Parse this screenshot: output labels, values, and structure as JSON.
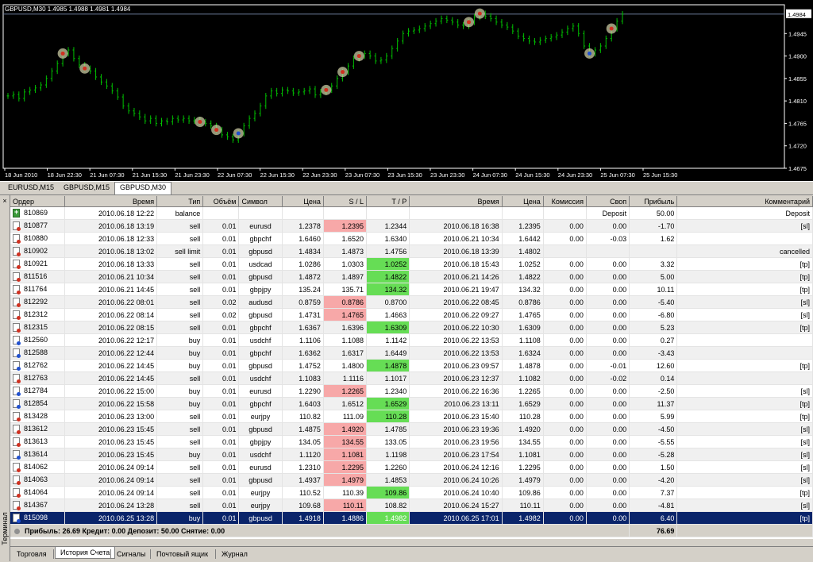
{
  "chart": {
    "title": "GBPUSD,M30  1.4985 1.4988 1.4981 1.4984",
    "current_price": "1.4984",
    "price_labels": [
      "1.4945",
      "1.4900",
      "1.4855",
      "1.4810",
      "1.4765",
      "1.4720",
      "1.4675"
    ],
    "time_labels": [
      "18 Jun 2010",
      "18 Jun 22:30",
      "21 Jun 07:30",
      "21 Jun 15:30",
      "21 Jun 23:30",
      "22 Jun 07:30",
      "22 Jun 15:30",
      "22 Jun 23:30",
      "23 Jun 07:30",
      "23 Jun 15:30",
      "23 Jun 23:30",
      "24 Jun 07:30",
      "24 Jun 15:30",
      "24 Jun 23:30",
      "25 Jun 07:30",
      "25 Jun 15:30"
    ],
    "colors": {
      "background": "#000000",
      "bars": "#00c000",
      "grid": "#ffffff",
      "sell_marker": "#d03020",
      "buy_marker": "#2050d0",
      "marker_ring": "#c8c8a0"
    },
    "series": [
      1.482,
      1.4823,
      1.4815,
      1.4828,
      1.4832,
      1.4836,
      1.4842,
      1.4855,
      1.487,
      1.4885,
      1.4905,
      1.4912,
      1.4895,
      1.4882,
      1.4875,
      1.487,
      1.4858,
      1.4848,
      1.484,
      1.483,
      1.4818,
      1.48,
      1.479,
      1.4785,
      1.4778,
      1.477,
      1.4775,
      1.4765,
      1.477,
      1.4768,
      1.4775,
      1.4772,
      1.4775,
      1.477,
      1.4772,
      1.4768,
      1.4765,
      1.476,
      1.4752,
      1.4742,
      1.4738,
      1.4732,
      1.4745,
      1.476,
      1.4775,
      1.4785,
      1.48,
      1.482,
      1.483,
      1.4825,
      1.4832,
      1.483,
      1.4826,
      1.4828,
      1.483,
      1.4834,
      1.4822,
      1.4828,
      1.4832,
      1.484,
      1.4855,
      1.4868,
      1.488,
      1.4895,
      1.49,
      1.4905,
      1.49,
      1.489,
      1.4892,
      1.49,
      1.4915,
      1.493,
      1.4945,
      1.495,
      1.4952,
      1.4955,
      1.496,
      1.4965,
      1.497,
      1.4975,
      1.4972,
      1.4968,
      1.4962,
      1.496,
      1.4968,
      1.4978,
      1.4985,
      1.498,
      1.4975,
      1.4968,
      1.4962,
      1.4958,
      1.495,
      1.494,
      1.4935,
      1.493,
      1.4928,
      1.4932,
      1.4935,
      1.4938,
      1.4942,
      1.4948,
      1.4955,
      1.496,
      1.4945,
      1.492,
      1.4905,
      1.4912,
      1.492,
      1.4935,
      1.4955,
      1.497,
      1.4984
    ],
    "trades": [
      {
        "side": "sell",
        "i": 10
      },
      {
        "side": "sell",
        "i": 14
      },
      {
        "side": "sell",
        "i": 35
      },
      {
        "side": "sell",
        "i": 38
      },
      {
        "side": "buy",
        "i": 42
      },
      {
        "side": "sell",
        "i": 58
      },
      {
        "side": "sell",
        "i": 61
      },
      {
        "side": "sell",
        "i": 64
      },
      {
        "side": "sell",
        "i": 84
      },
      {
        "side": "sell",
        "i": 86
      },
      {
        "side": "buy",
        "i": 106
      },
      {
        "side": "sell",
        "i": 110
      }
    ]
  },
  "chart_tabs": [
    "EURUSD,M15",
    "GBPUSD,M15",
    "GBPUSD,M30"
  ],
  "columns": [
    "Ордер",
    "Время",
    "Тип",
    "Объём",
    "Символ",
    "Цена",
    "S / L",
    "T / P",
    "Время",
    "Цена",
    "Комиссия",
    "Своп",
    "Прибыль",
    "Комментарий"
  ],
  "rows": [
    {
      "order": "810869",
      "time": "2010.06.18 12:22",
      "type": "balance",
      "vol": "",
      "sym": "",
      "price": "",
      "sl": "",
      "tp": "",
      "ctime": "",
      "cprice": "",
      "comm": "",
      "swap": "Deposit",
      "profit": "50.00",
      "comment": "Deposit",
      "icon": "bal",
      "sl_c": "",
      "tp_c": ""
    },
    {
      "order": "810877",
      "time": "2010.06.18 13:19",
      "type": "sell",
      "vol": "0.01",
      "sym": "eurusd",
      "price": "1.2378",
      "sl": "1.2395",
      "tp": "1.2344",
      "ctime": "2010.06.18 16:38",
      "cprice": "1.2395",
      "comm": "0.00",
      "swap": "0.00",
      "profit": "-1.70",
      "comment": "[sl]",
      "icon": "sell",
      "sl_c": "red",
      "tp_c": ""
    },
    {
      "order": "810880",
      "time": "2010.06.18 12:33",
      "type": "sell",
      "vol": "0.01",
      "sym": "gbpchf",
      "price": "1.6460",
      "sl": "1.6520",
      "tp": "1.6340",
      "ctime": "2010.06.21 10:34",
      "cprice": "1.6442",
      "comm": "0.00",
      "swap": "-0.03",
      "profit": "1.62",
      "comment": "",
      "icon": "sell",
      "sl_c": "",
      "tp_c": ""
    },
    {
      "order": "810902",
      "time": "2010.06.18 13:02",
      "type": "sell limit",
      "vol": "0.01",
      "sym": "gbpusd",
      "price": "1.4834",
      "sl": "1.4873",
      "tp": "1.4756",
      "ctime": "2010.06.18 13:39",
      "cprice": "1.4802",
      "comm": "",
      "swap": "",
      "profit": "",
      "comment": "cancelled",
      "icon": "sell",
      "sl_c": "",
      "tp_c": ""
    },
    {
      "order": "810921",
      "time": "2010.06.18 13:33",
      "type": "sell",
      "vol": "0.01",
      "sym": "usdcad",
      "price": "1.0286",
      "sl": "1.0303",
      "tp": "1.0252",
      "ctime": "2010.06.18 15:43",
      "cprice": "1.0252",
      "comm": "0.00",
      "swap": "0.00",
      "profit": "3.32",
      "comment": "[tp]",
      "icon": "sell",
      "sl_c": "",
      "tp_c": "green"
    },
    {
      "order": "811516",
      "time": "2010.06.21 10:34",
      "type": "sell",
      "vol": "0.01",
      "sym": "gbpusd",
      "price": "1.4872",
      "sl": "1.4897",
      "tp": "1.4822",
      "ctime": "2010.06.21 14:26",
      "cprice": "1.4822",
      "comm": "0.00",
      "swap": "0.00",
      "profit": "5.00",
      "comment": "[tp]",
      "icon": "sell",
      "sl_c": "",
      "tp_c": "green"
    },
    {
      "order": "811764",
      "time": "2010.06.21 14:45",
      "type": "sell",
      "vol": "0.01",
      "sym": "gbpjpy",
      "price": "135.24",
      "sl": "135.71",
      "tp": "134.32",
      "ctime": "2010.06.21 19:47",
      "cprice": "134.32",
      "comm": "0.00",
      "swap": "0.00",
      "profit": "10.11",
      "comment": "[tp]",
      "icon": "sell",
      "sl_c": "",
      "tp_c": "green"
    },
    {
      "order": "812292",
      "time": "2010.06.22 08:01",
      "type": "sell",
      "vol": "0.02",
      "sym": "audusd",
      "price": "0.8759",
      "sl": "0.8786",
      "tp": "0.8700",
      "ctime": "2010.06.22 08:45",
      "cprice": "0.8786",
      "comm": "0.00",
      "swap": "0.00",
      "profit": "-5.40",
      "comment": "[sl]",
      "icon": "sell",
      "sl_c": "red",
      "tp_c": ""
    },
    {
      "order": "812312",
      "time": "2010.06.22 08:14",
      "type": "sell",
      "vol": "0.02",
      "sym": "gbpusd",
      "price": "1.4731",
      "sl": "1.4765",
      "tp": "1.4663",
      "ctime": "2010.06.22 09:27",
      "cprice": "1.4765",
      "comm": "0.00",
      "swap": "0.00",
      "profit": "-6.80",
      "comment": "[sl]",
      "icon": "sell",
      "sl_c": "red",
      "tp_c": ""
    },
    {
      "order": "812315",
      "time": "2010.06.22 08:15",
      "type": "sell",
      "vol": "0.01",
      "sym": "gbpchf",
      "price": "1.6367",
      "sl": "1.6396",
      "tp": "1.6309",
      "ctime": "2010.06.22 10:30",
      "cprice": "1.6309",
      "comm": "0.00",
      "swap": "0.00",
      "profit": "5.23",
      "comment": "[tp]",
      "icon": "sell",
      "sl_c": "",
      "tp_c": "green"
    },
    {
      "order": "812560",
      "time": "2010.06.22 12:17",
      "type": "buy",
      "vol": "0.01",
      "sym": "usdchf",
      "price": "1.1106",
      "sl": "1.1088",
      "tp": "1.1142",
      "ctime": "2010.06.22 13:53",
      "cprice": "1.1108",
      "comm": "0.00",
      "swap": "0.00",
      "profit": "0.27",
      "comment": "",
      "icon": "buy",
      "sl_c": "",
      "tp_c": ""
    },
    {
      "order": "812588",
      "time": "2010.06.22 12:44",
      "type": "buy",
      "vol": "0.01",
      "sym": "gbpchf",
      "price": "1.6362",
      "sl": "1.6317",
      "tp": "1.6449",
      "ctime": "2010.06.22 13:53",
      "cprice": "1.6324",
      "comm": "0.00",
      "swap": "0.00",
      "profit": "-3.43",
      "comment": "",
      "icon": "buy",
      "sl_c": "",
      "tp_c": ""
    },
    {
      "order": "812762",
      "time": "2010.06.22 14:45",
      "type": "buy",
      "vol": "0.01",
      "sym": "gbpusd",
      "price": "1.4752",
      "sl": "1.4800",
      "tp": "1.4878",
      "ctime": "2010.06.23 09:57",
      "cprice": "1.4878",
      "comm": "0.00",
      "swap": "-0.01",
      "profit": "12.60",
      "comment": "[tp]",
      "icon": "buy",
      "sl_c": "",
      "tp_c": "green"
    },
    {
      "order": "812763",
      "time": "2010.06.22 14:45",
      "type": "sell",
      "vol": "0.01",
      "sym": "usdchf",
      "price": "1.1083",
      "sl": "1.1116",
      "tp": "1.1017",
      "ctime": "2010.06.23 12:37",
      "cprice": "1.1082",
      "comm": "0.00",
      "swap": "-0.02",
      "profit": "0.14",
      "comment": "",
      "icon": "sell",
      "sl_c": "",
      "tp_c": ""
    },
    {
      "order": "812784",
      "time": "2010.06.22 15:00",
      "type": "buy",
      "vol": "0.01",
      "sym": "eurusd",
      "price": "1.2290",
      "sl": "1.2265",
      "tp": "1.2340",
      "ctime": "2010.06.22 16:36",
      "cprice": "1.2265",
      "comm": "0.00",
      "swap": "0.00",
      "profit": "-2.50",
      "comment": "[sl]",
      "icon": "buy",
      "sl_c": "red",
      "tp_c": ""
    },
    {
      "order": "812854",
      "time": "2010.06.22 15:58",
      "type": "buy",
      "vol": "0.01",
      "sym": "gbpchf",
      "price": "1.6403",
      "sl": "1.6512",
      "tp": "1.6529",
      "ctime": "2010.06.23 13:11",
      "cprice": "1.6529",
      "comm": "0.00",
      "swap": "0.00",
      "profit": "11.37",
      "comment": "[tp]",
      "icon": "buy",
      "sl_c": "",
      "tp_c": "green"
    },
    {
      "order": "813428",
      "time": "2010.06.23 13:00",
      "type": "sell",
      "vol": "0.01",
      "sym": "eurjpy",
      "price": "110.82",
      "sl": "111.09",
      "tp": "110.28",
      "ctime": "2010.06.23 15:40",
      "cprice": "110.28",
      "comm": "0.00",
      "swap": "0.00",
      "profit": "5.99",
      "comment": "[tp]",
      "icon": "sell",
      "sl_c": "",
      "tp_c": "green"
    },
    {
      "order": "813612",
      "time": "2010.06.23 15:45",
      "type": "sell",
      "vol": "0.01",
      "sym": "gbpusd",
      "price": "1.4875",
      "sl": "1.4920",
      "tp": "1.4785",
      "ctime": "2010.06.23 19:36",
      "cprice": "1.4920",
      "comm": "0.00",
      "swap": "0.00",
      "profit": "-4.50",
      "comment": "[sl]",
      "icon": "sell",
      "sl_c": "red",
      "tp_c": ""
    },
    {
      "order": "813613",
      "time": "2010.06.23 15:45",
      "type": "sell",
      "vol": "0.01",
      "sym": "gbpjpy",
      "price": "134.05",
      "sl": "134.55",
      "tp": "133.05",
      "ctime": "2010.06.23 19:56",
      "cprice": "134.55",
      "comm": "0.00",
      "swap": "0.00",
      "profit": "-5.55",
      "comment": "[sl]",
      "icon": "sell",
      "sl_c": "red",
      "tp_c": ""
    },
    {
      "order": "813614",
      "time": "2010.06.23 15:45",
      "type": "buy",
      "vol": "0.01",
      "sym": "usdchf",
      "price": "1.1120",
      "sl": "1.1081",
      "tp": "1.1198",
      "ctime": "2010.06.23 17:54",
      "cprice": "1.1081",
      "comm": "0.00",
      "swap": "0.00",
      "profit": "-5.28",
      "comment": "[sl]",
      "icon": "buy",
      "sl_c": "red",
      "tp_c": ""
    },
    {
      "order": "814062",
      "time": "2010.06.24 09:14",
      "type": "sell",
      "vol": "0.01",
      "sym": "eurusd",
      "price": "1.2310",
      "sl": "1.2295",
      "tp": "1.2260",
      "ctime": "2010.06.24 12:16",
      "cprice": "1.2295",
      "comm": "0.00",
      "swap": "0.00",
      "profit": "1.50",
      "comment": "[sl]",
      "icon": "sell",
      "sl_c": "red",
      "tp_c": ""
    },
    {
      "order": "814063",
      "time": "2010.06.24 09:14",
      "type": "sell",
      "vol": "0.01",
      "sym": "gbpusd",
      "price": "1.4937",
      "sl": "1.4979",
      "tp": "1.4853",
      "ctime": "2010.06.24 10:26",
      "cprice": "1.4979",
      "comm": "0.00",
      "swap": "0.00",
      "profit": "-4.20",
      "comment": "[sl]",
      "icon": "sell",
      "sl_c": "red",
      "tp_c": ""
    },
    {
      "order": "814064",
      "time": "2010.06.24 09:14",
      "type": "sell",
      "vol": "0.01",
      "sym": "eurjpy",
      "price": "110.52",
      "sl": "110.39",
      "tp": "109.86",
      "ctime": "2010.06.24 10:40",
      "cprice": "109.86",
      "comm": "0.00",
      "swap": "0.00",
      "profit": "7.37",
      "comment": "[tp]",
      "icon": "sell",
      "sl_c": "",
      "tp_c": "green"
    },
    {
      "order": "814367",
      "time": "2010.06.24 13:28",
      "type": "sell",
      "vol": "0.01",
      "sym": "eurjpy",
      "price": "109.68",
      "sl": "110.11",
      "tp": "108.82",
      "ctime": "2010.06.24 15:27",
      "cprice": "110.11",
      "comm": "0.00",
      "swap": "0.00",
      "profit": "-4.81",
      "comment": "[sl]",
      "icon": "sell",
      "sl_c": "red",
      "tp_c": ""
    },
    {
      "order": "815098",
      "time": "2010.06.25 13:28",
      "type": "buy",
      "vol": "0.01",
      "sym": "gbpusd",
      "price": "1.4918",
      "sl": "1.4886",
      "tp": "1.4982",
      "ctime": "2010.06.25 17:01",
      "cprice": "1.4982",
      "comm": "0.00",
      "swap": "0.00",
      "profit": "6.40",
      "comment": "[tp]",
      "icon": "buy",
      "sl_c": "",
      "tp_c": "green",
      "selected": true
    }
  ],
  "summary": {
    "text": "Прибыль: 26.69  Кредит: 0.00  Депозит: 50.00  Снятие: 0.00",
    "total": "76.69"
  },
  "sidebar_label": "Терминал",
  "close_glyph": "×",
  "bottom_tabs": [
    "Торговля",
    "История Счета",
    "Сигналы",
    "Почтовый ящик",
    "Журнал"
  ],
  "active_bottom_tab": 1
}
